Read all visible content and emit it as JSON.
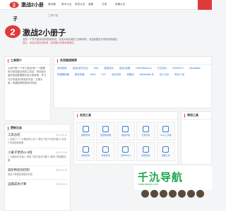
{
  "nav": {
    "brand": "激战2小册",
    "menu": [
      "服务器",
      "新手大全",
      "特性大全",
      "装备",
      "日常",
      "攻略大全"
    ]
  },
  "breadcrumb": "工具介绍",
  "hero": {
    "char": "子",
    "title": "激战2小册子",
    "desc": "这是一个关于激战2游戏的资料站，包含大量实用的工具和资料，欢迎收藏并分享给你的朋友。",
    "note": "提示：本站内容仅供参考，如有疑问请联系管理员。"
  },
  "about": {
    "title": "工具简介",
    "text": "小册子是一个关于激战2的一个数据库与信息整合网站工具站，现在能大量的信息数据展示给大家使用，学习与分享激战2的相关内容，方便大家。希望能帮助更多的玩家。"
  },
  "links": {
    "title": "实用链接推荐",
    "items": [
      "游戏官网",
      "激战2官方论坛",
      "Wiki",
      "维基百科",
      "激战2地图",
      "GW2Efficiency",
      "中文百科",
      "GW2BLTC",
      "Metabattle",
      "构建模拟器",
      "副本攻略",
      "WvW",
      "PvP",
      "活动日历",
      "攻略站",
      "Metabattle 站",
      "战斗日志",
      "职业介绍"
    ]
  },
  "news": {
    "title": "更新日志",
    "items": [
      {
        "title": "工具总结",
        "date": "2023-04-19",
        "body": "1. 增加了一个价格查询工具 2. 修复了若干已知问题 3. 优化了页面加载速度"
      },
      {
        "title": "小册子更新v1.5版",
        "date": "2022-12-04",
        "body": "1. 功能优化升级 2. 修复了部分显示问题 3. 新增了配装模拟器"
      },
      {
        "title": "高阶种族的控制",
        "date": "2022-01-16",
        "body": "增加了种族控制相关内容"
      },
      {
        "title": "运输成本计算",
        "date": "2022-01-01",
        "body": ""
      }
    ]
  },
  "tools": {
    "title": "实用工具",
    "items": [
      "数据查询",
      "配装模拟器",
      "物品价格",
      "日常任务",
      "Timer工具集",
      "技能查询",
      "特性查询",
      "世界BOSS",
      "成就查询",
      "地图工具"
    ]
  },
  "side": {
    "title": "常用工具"
  },
  "banner": {
    "text": "千氿导航",
    "url": "www.qianjiu.com"
  }
}
